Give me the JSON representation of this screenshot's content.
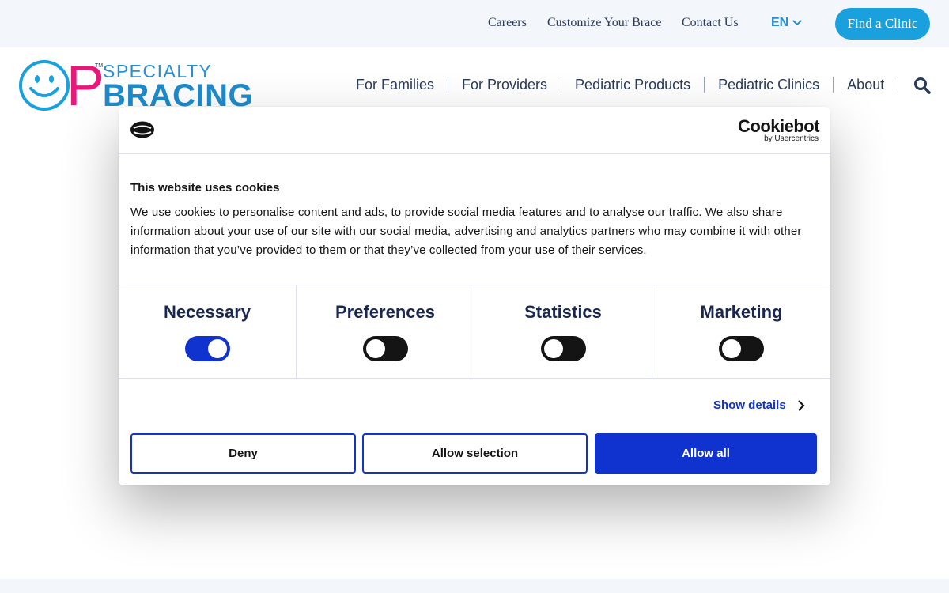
{
  "topbar": {
    "links": [
      "Careers",
      "Customize Your Brace",
      "Contact Us"
    ],
    "language": "EN",
    "find_clinic": "Find a Clinic"
  },
  "logo": {
    "letter": "P",
    "tm": "TM",
    "specialty": "SPECIALTY",
    "bracing": "BRACING"
  },
  "nav": {
    "items": [
      "For Families",
      "For Providers",
      "Pediatric Products",
      "Pediatric Clinics",
      "About"
    ]
  },
  "cookie_dialog": {
    "brand": "Cookiebot",
    "brand_by": "by Usercentrics",
    "title": "This website uses cookies",
    "text": "We use cookies to personalise content and ads, to provide social media features and to analyse our traffic. We also share information about your use of our site with our social media, advertising and analytics partners who may combine it with other information that you’ve provided to them or that they’ve collected from your use of their services.",
    "categories": [
      {
        "label": "Necessary",
        "enabled": true
      },
      {
        "label": "Preferences",
        "enabled": false
      },
      {
        "label": "Statistics",
        "enabled": false
      },
      {
        "label": "Marketing",
        "enabled": false
      }
    ],
    "show_details": "Show details",
    "buttons": {
      "deny": "Deny",
      "allow_selection": "Allow selection",
      "allow_all": "Allow all"
    }
  },
  "colors": {
    "accent_blue": "#1032cf",
    "brand_cyan": "#1aa0dd",
    "brand_pink": "#e6197a",
    "nav_text": "#2a3a5a"
  },
  "icons": {
    "language": "chevron-down-icon",
    "search": "search-icon",
    "details": "chevron-right-icon",
    "consent": "cookie-logo-icon"
  }
}
